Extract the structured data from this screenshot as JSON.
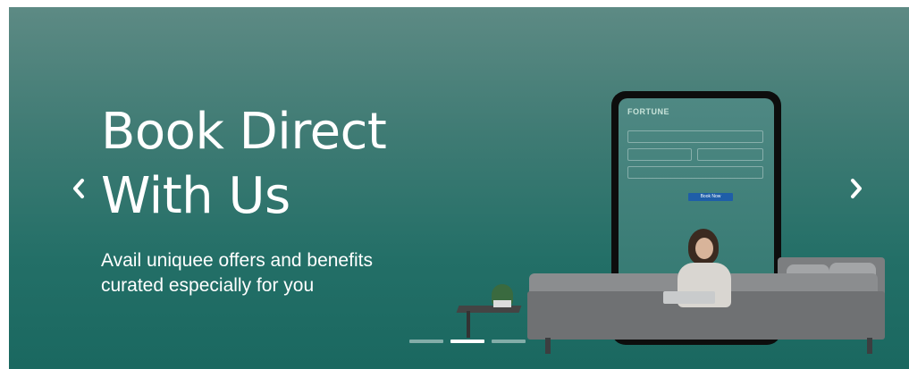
{
  "banner": {
    "headline_line1": "Book Direct",
    "headline_line2": "With Us",
    "subline_line1": "Avail uniquee offers and benefits",
    "subline_line2": "curated especially for you",
    "phone_logo": "FORTUNE",
    "phone_button": "Book Now",
    "icons": {
      "prev": "chevron-left-icon",
      "next": "chevron-right-icon"
    },
    "slides": {
      "count": 3,
      "active": 2
    },
    "colors": {
      "background_top": "#5d8a84",
      "background_bottom": "#1a6860",
      "text": "#ffffff",
      "phone_button": "#1f5ea8"
    }
  }
}
